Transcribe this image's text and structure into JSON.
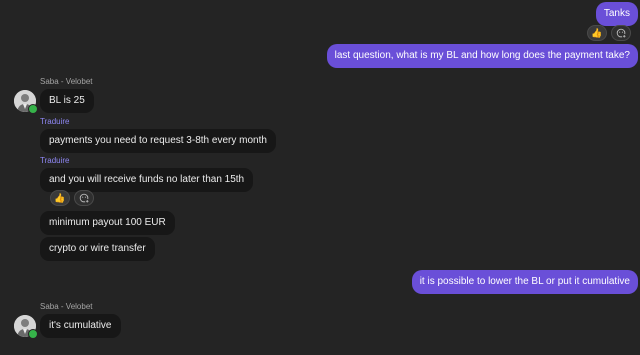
{
  "outgoing_top": {
    "text": "Tanks",
    "reactions": [
      {
        "icon": "thumbs-up-icon",
        "glyph": "👍"
      },
      {
        "icon": "add-reaction-icon"
      }
    ]
  },
  "outgoing_question": "last question, what is my BL and how long does the payment take?",
  "group1": {
    "sender": "Saba - Velobet",
    "messages": [
      {
        "text": "BL is 25",
        "translate": "Traduire"
      },
      {
        "text": "payments you need to request 3-8th every month",
        "translate": "Traduire"
      },
      {
        "text": "and you will receive funds no later than 15th"
      },
      {
        "text": "minimum payout 100 EUR"
      },
      {
        "text": "crypto or wire transfer"
      }
    ],
    "reactions": [
      {
        "icon": "thumbs-up-icon",
        "glyph": "👍"
      },
      {
        "icon": "add-reaction-icon"
      }
    ]
  },
  "outgoing_cumulative": "it is possible to lower the BL or put it cumulative",
  "group2": {
    "sender": "Saba - Velobet",
    "messages": [
      {
        "text": "it's cumulative"
      }
    ]
  },
  "colors": {
    "background": "#242424",
    "outgoing_bubble": "#6a4fd8",
    "incoming_bubble": "#171717",
    "translate_link": "#8f87f4",
    "online_status": "#36b34a"
  }
}
